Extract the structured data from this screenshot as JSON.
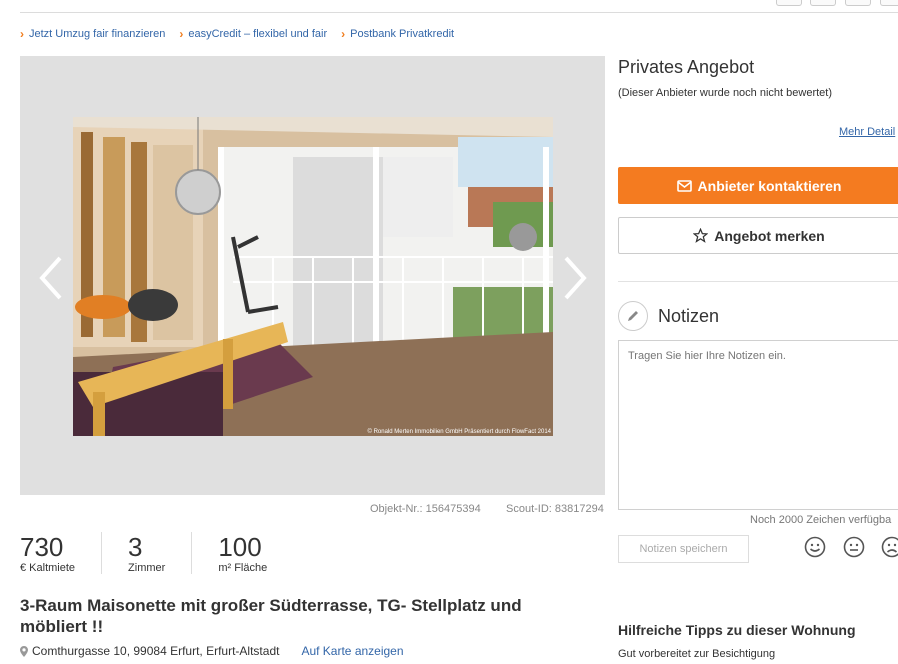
{
  "promo_links": [
    "Jetzt Umzug fair finanzieren",
    "easyCredit – flexibel und fair",
    "Postbank Privatkredit"
  ],
  "gallery": {
    "watermark": "© Ronald Merten Immobilien GmbH  Präsentiert durch FlowFact 2014",
    "object_nr": "Objekt-Nr.: 156475394",
    "scout_id": "Scout-ID: 83817294"
  },
  "stats": [
    {
      "value": "730",
      "label": "€ Kaltmiete"
    },
    {
      "value": "3",
      "label": "Zimmer"
    },
    {
      "value": "100",
      "label": "m² Fläche"
    }
  ],
  "listing": {
    "title": "3-Raum Maisonette mit großer Südterrasse, TG- Stellplatz und möbliert !!",
    "address": "Comthurgasse 10, 99084 Erfurt, Erfurt-Altstadt",
    "map_link": "Auf Karte anzeigen"
  },
  "provider": {
    "title": "Privates Angebot",
    "subtitle": "(Dieser Anbieter wurde noch nicht bewertet)",
    "more_link": "Mehr Detail",
    "contact_label": "Anbieter kontaktieren",
    "save_label": "Angebot merken"
  },
  "notes": {
    "title": "Notizen",
    "placeholder": "Tragen Sie hier Ihre Notizen ein.",
    "counter": "Noch 2000 Zeichen verfügba",
    "save_label": "Notizen speichern"
  },
  "tips": {
    "title": "Hilfreiche Tipps zu dieser Wohnung",
    "subtitle": "Gut vorbereitet zur Besichtigung"
  },
  "colors": {
    "accent": "#f47b20",
    "link": "#3366a8"
  }
}
